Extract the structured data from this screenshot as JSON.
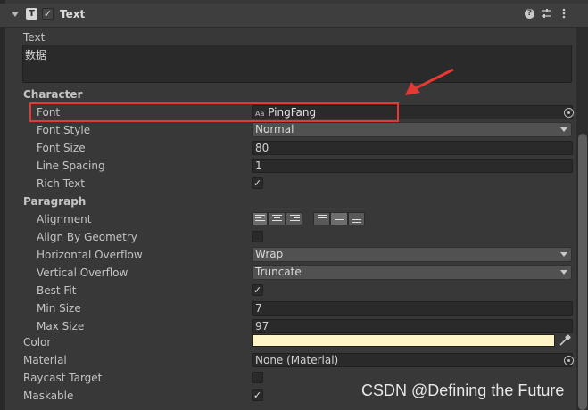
{
  "component": {
    "title": "Text",
    "enabled": true,
    "header_icons": [
      "help-icon",
      "preset-icon",
      "context-menu-icon"
    ]
  },
  "text_label": "Text",
  "text_value": "数据",
  "sections": {
    "character": "Character",
    "paragraph": "Paragraph"
  },
  "fields": {
    "font_label": "Font",
    "font_value": "PingFang",
    "font_icon_text": "Aa",
    "font_style_label": "Font Style",
    "font_style_value": "Normal",
    "font_size_label": "Font Size",
    "font_size_value": "80",
    "line_spacing_label": "Line Spacing",
    "line_spacing_value": "1",
    "rich_text_label": "Rich Text",
    "rich_text_checked": true,
    "alignment_label": "Alignment",
    "align_by_geometry_label": "Align By Geometry",
    "align_by_geometry_checked": false,
    "horizontal_overflow_label": "Horizontal Overflow",
    "horizontal_overflow_value": "Wrap",
    "vertical_overflow_label": "Vertical Overflow",
    "vertical_overflow_value": "Truncate",
    "best_fit_label": "Best Fit",
    "best_fit_checked": true,
    "min_size_label": "Min Size",
    "min_size_value": "7",
    "max_size_label": "Max Size",
    "max_size_value": "97",
    "color_label": "Color",
    "color_value": "#fdf5c8",
    "material_label": "Material",
    "material_value": "None (Material)",
    "raycast_target_label": "Raycast Target",
    "raycast_target_checked": false,
    "maskable_label": "Maskable",
    "maskable_checked": true
  },
  "alignment": {
    "horizontal": [
      "left",
      "center",
      "right"
    ],
    "horizontal_selected": "left",
    "vertical": [
      "top",
      "middle",
      "bottom"
    ],
    "vertical_selected": "middle"
  },
  "annotation": {
    "highlight_color": "#e53935",
    "arrow_color": "#e53935"
  },
  "watermark": "CSDN @Defining the Future"
}
